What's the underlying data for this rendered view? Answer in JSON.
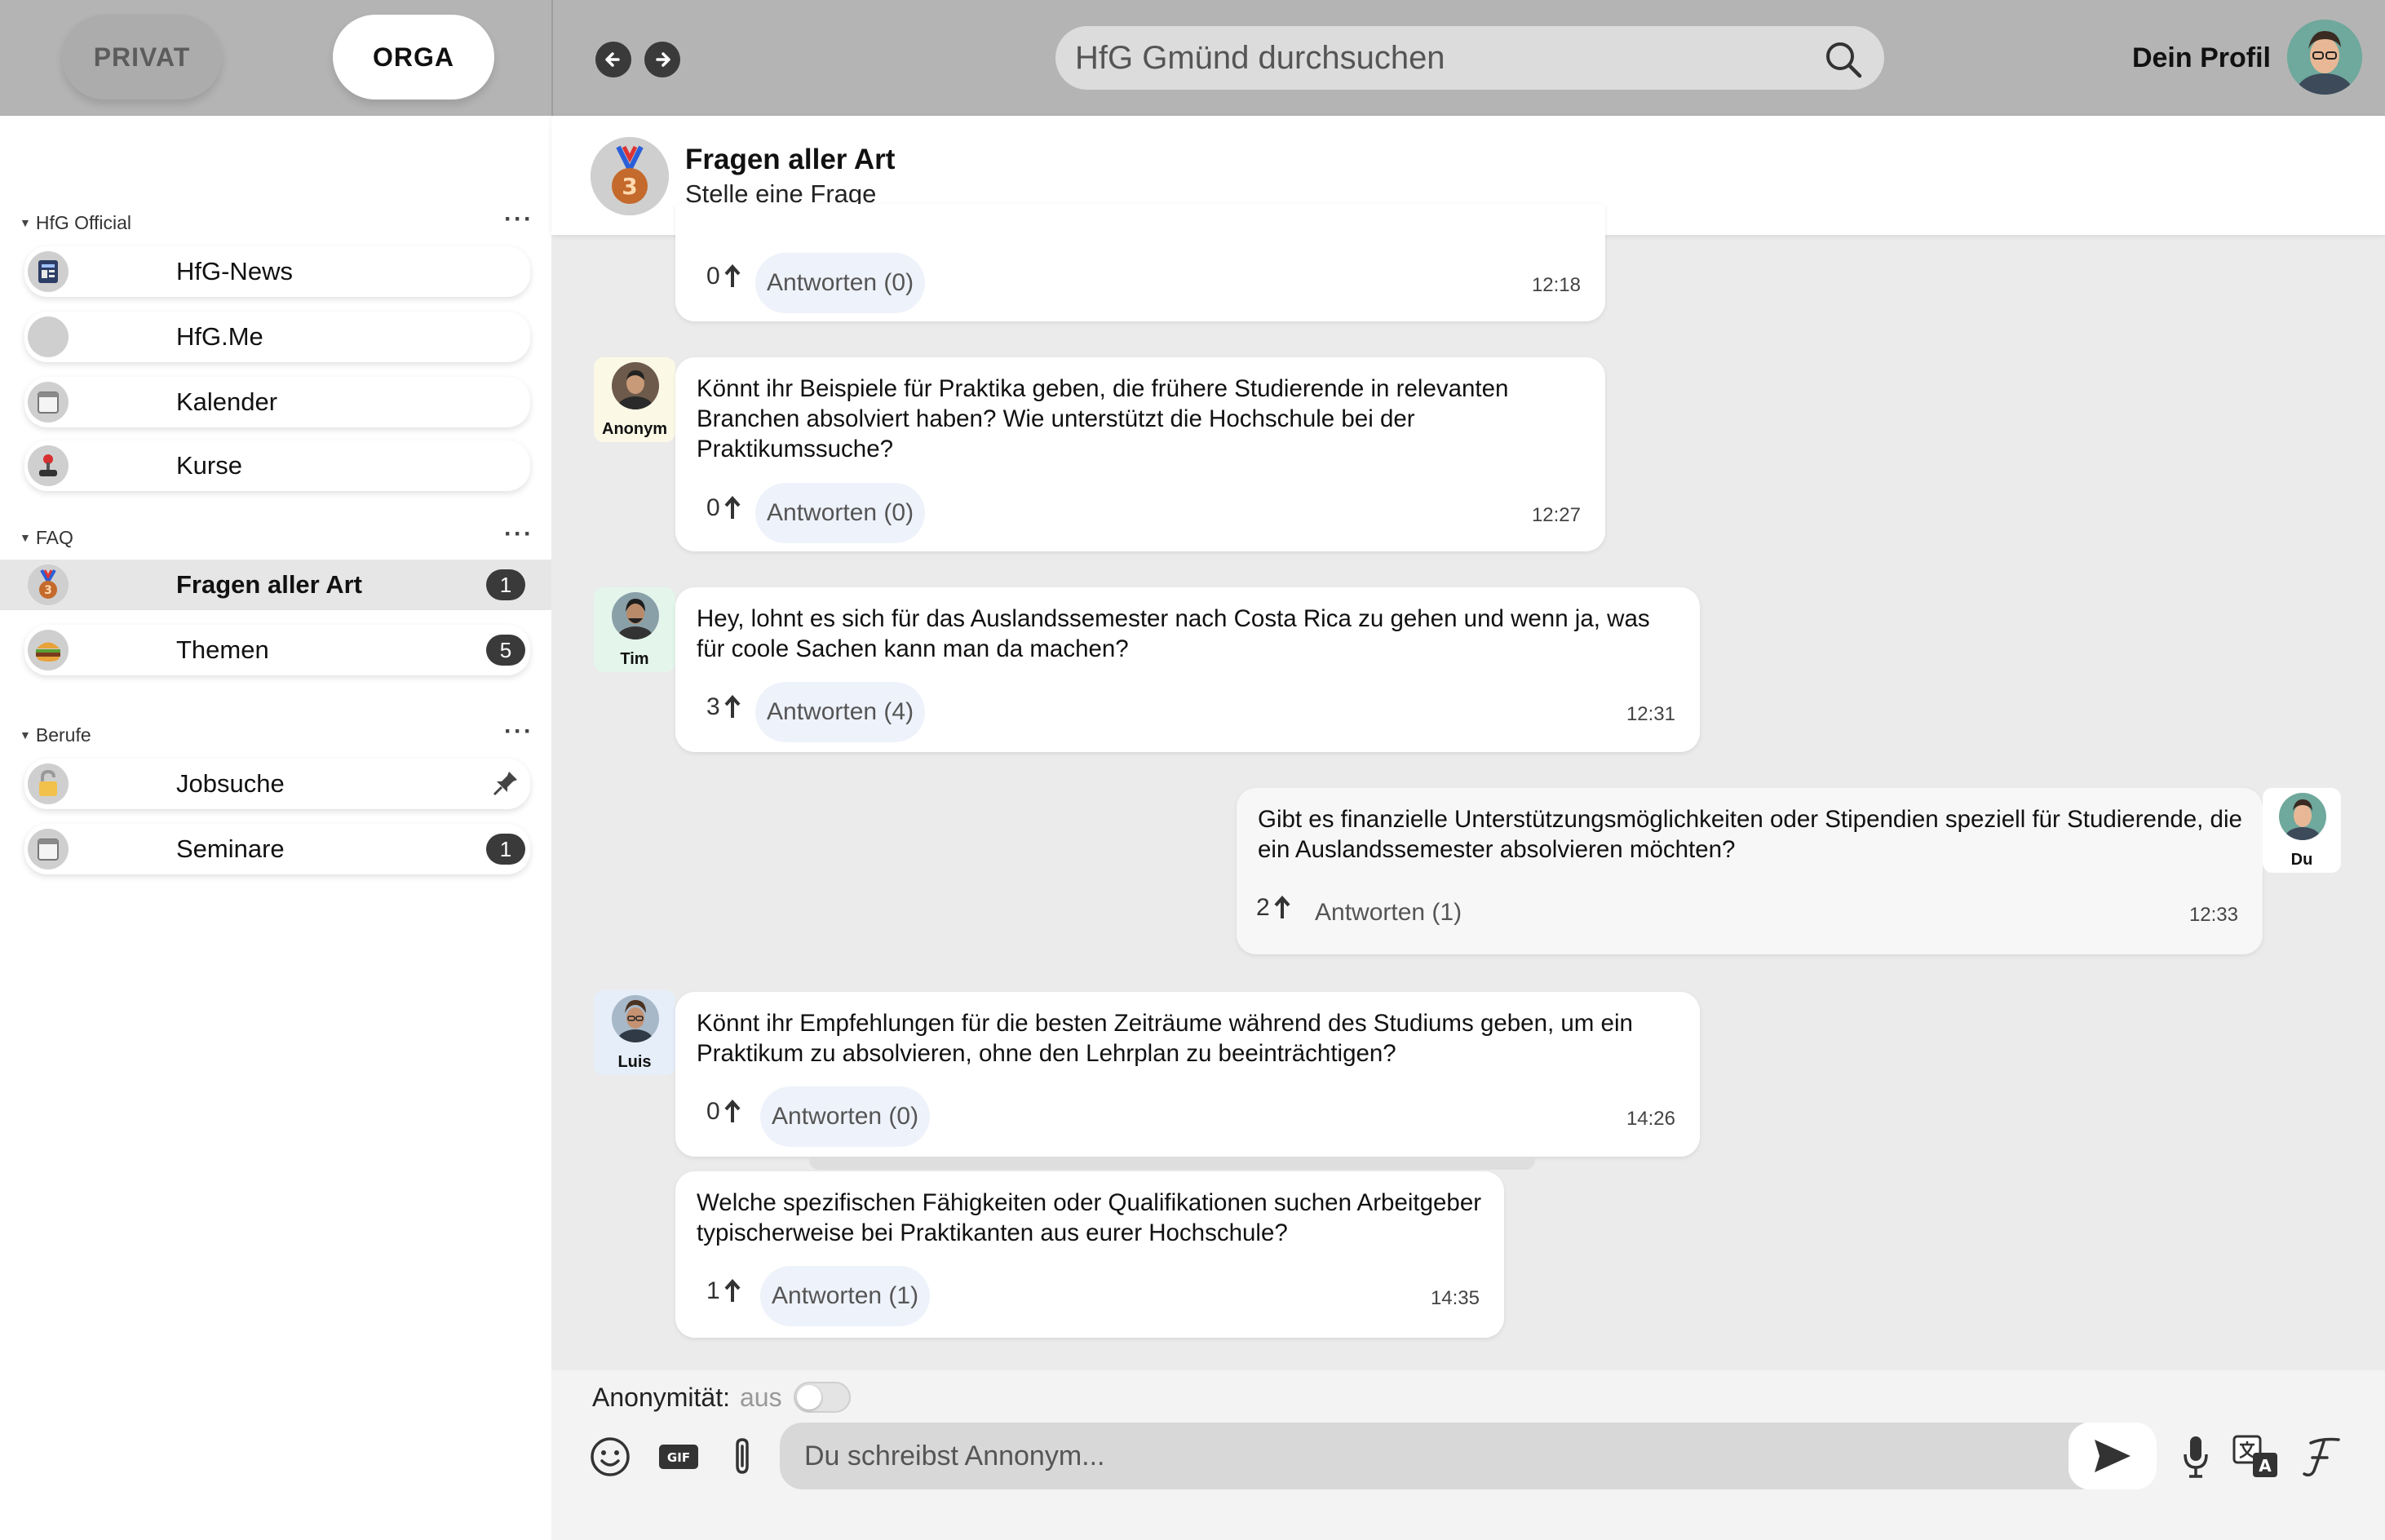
{
  "sidebar": {
    "tabs": [
      {
        "label": "PRIVAT",
        "active": false
      },
      {
        "label": "ORGA",
        "active": true
      }
    ],
    "sections": [
      {
        "title": "HfG Official",
        "items": [
          {
            "label": "HfG-News",
            "icon": "newspaper-icon"
          },
          {
            "label": "HfG.Me",
            "icon": "blank-icon"
          },
          {
            "label": "Kalender",
            "icon": "calendar-icon"
          },
          {
            "label": "Kurse",
            "icon": "joystick-icon"
          }
        ]
      },
      {
        "title": "FAQ",
        "items": [
          {
            "label": "Fragen aller Art",
            "icon": "medal-icon",
            "badge": "1",
            "active": true
          },
          {
            "label": "Themen",
            "icon": "burger-icon",
            "badge": "5"
          }
        ]
      },
      {
        "title": "Berufe",
        "items": [
          {
            "label": "Jobsuche",
            "icon": "lock-icon",
            "pinned": true
          },
          {
            "label": "Seminare",
            "icon": "calendar-icon",
            "badge": "1"
          }
        ]
      }
    ]
  },
  "topbar": {
    "search_placeholder": "HfG Gmünd durchsuchen",
    "profile_label": "Dein Profil"
  },
  "channel": {
    "title": "Fragen aller Art",
    "subtitle": "Stelle eine Frage",
    "medal_number": "3"
  },
  "messages": [
    {
      "author": "",
      "text": "",
      "votes": "0",
      "reply_label": "Antworten (0)",
      "time": "12:18"
    },
    {
      "author": "Anonym",
      "text": "Könnt ihr Beispiele für Praktika geben, die frühere Studierende in relevanten Branchen absolviert haben? Wie unterstützt die Hochschule bei der Praktikumssuche?",
      "votes": "0",
      "reply_label": "Antworten (0)",
      "time": "12:27"
    },
    {
      "author": "Tim",
      "text": "Hey, lohnt es sich für das Auslandssemester nach Costa Rica zu gehen und wenn ja, was für coole Sachen kann man da machen?",
      "votes": "3",
      "reply_label": "Antworten (4)",
      "time": "12:31"
    },
    {
      "author": "Du",
      "text": "Gibt es finanzielle Unterstützungsmöglichkeiten oder Stipendien speziell für Studierende, die ein Auslandssemester absolvieren möchten?",
      "votes": "2",
      "reply_label": "Antworten (1)",
      "time": "12:33"
    },
    {
      "author": "Luis",
      "text": "Könnt ihr Empfehlungen für die besten Zeiträume während des Studiums geben, um ein Praktikum zu absolvieren, ohne den Lehrplan zu beeinträchtigen?",
      "votes": "0",
      "reply_label": "Antworten (0)",
      "time": "14:26"
    },
    {
      "author": "Luis",
      "text": "Welche spezifischen Fähigkeiten oder Qualifikationen suchen Arbeitgeber typischerweise bei Praktikanten aus eurer Hochschule?",
      "votes": "1",
      "reply_label": "Antworten (1)",
      "time": "14:35"
    }
  ],
  "composer": {
    "anon_label": "Anonymität:",
    "anon_state": "aus",
    "placeholder": "Du schreibst Annonym...",
    "gif_label": "GIF"
  },
  "colors": {
    "topbar_bg": "#b4b4b4",
    "chat_bg": "#ebebeb",
    "reply_pill": "#eef2fa",
    "badge": "#3a3a3a",
    "avatar_teal": "#6fa89c"
  }
}
